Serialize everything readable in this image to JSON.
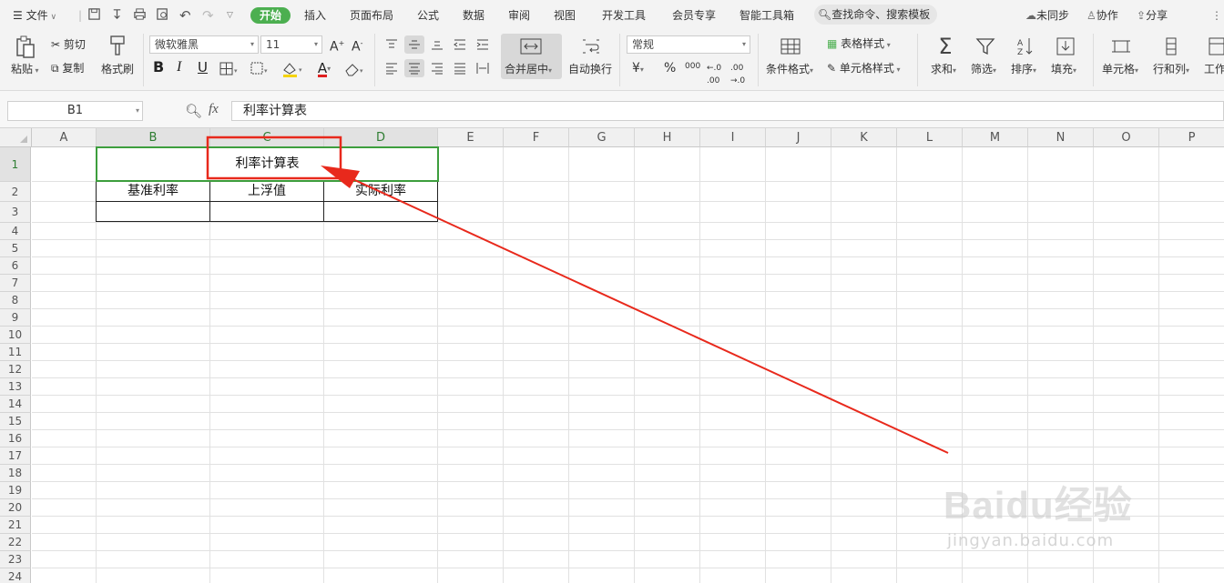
{
  "menubar": {
    "file": "文件",
    "tabs": [
      "开始",
      "插入",
      "页面布局",
      "公式",
      "数据",
      "审阅",
      "视图",
      "开发工具",
      "会员专享",
      "智能工具箱"
    ],
    "search": "查找命令、搜索模板",
    "sync": "未同步",
    "collab": "协作",
    "share": "分享"
  },
  "ribbon": {
    "paste": "粘贴",
    "cut": "剪切",
    "copy": "复制",
    "format_painter": "格式刷",
    "font_name": "微软雅黑",
    "font_size": "11",
    "merge_center": "合并居中",
    "wrap_text": "自动换行",
    "number_format": "常规",
    "cond_format": "条件格式",
    "table_style": "表格样式",
    "cell_style": "单元格样式",
    "sum": "求和",
    "filter": "筛选",
    "sort": "排序",
    "fill": "填充",
    "cells": "单元格",
    "rows_cols": "行和列",
    "worksheet": "工作",
    "bold": "B",
    "italic": "I",
    "underline": "U",
    "font_color_glyph": "A",
    "currency": "¥",
    "percent": "%",
    "thousands": "000"
  },
  "formula_bar": {
    "name_box": "B1",
    "fx": "fx",
    "content": "利率计算表"
  },
  "sheet": {
    "columns": [
      "A",
      "B",
      "C",
      "D",
      "E",
      "F",
      "G",
      "H",
      "I",
      "J",
      "K",
      "L",
      "M",
      "N",
      "O",
      "P"
    ],
    "rows": [
      "1",
      "2",
      "3",
      "4",
      "5",
      "6",
      "7",
      "8",
      "9",
      "10",
      "11",
      "12",
      "13",
      "14",
      "15",
      "16",
      "17",
      "18",
      "19",
      "20",
      "21",
      "22",
      "23",
      "24"
    ],
    "title": "利率计算表",
    "headers": [
      "基准利率",
      "上浮值",
      "实际利率"
    ]
  },
  "colors": {
    "accent_green": "#4caf50",
    "selection_green": "#3d9e3d",
    "annotation_red": "#e8291c"
  },
  "watermark": {
    "brand": "Baidu经验",
    "url": "jingyan.baidu.com"
  }
}
